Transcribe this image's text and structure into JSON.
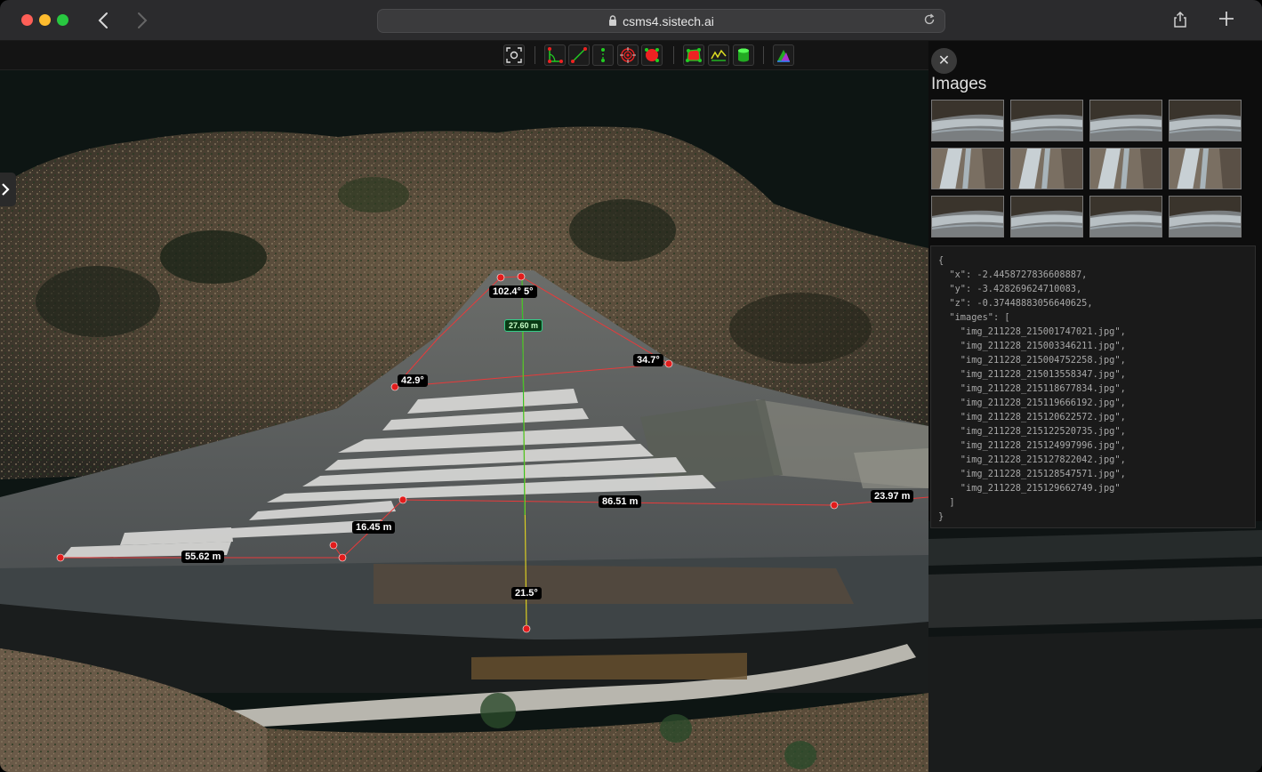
{
  "browser": {
    "url": "csms4.sistech.ai",
    "icons": [
      "back-icon",
      "forward-icon",
      "lock-icon",
      "reload-icon",
      "share-icon",
      "new-tab-icon"
    ]
  },
  "toolbar": {
    "tools": [
      {
        "name": "screenshot-tool",
        "icon": "camera-focus-icon"
      },
      {
        "name": "angle-tool",
        "icon": "angle-icon"
      },
      {
        "name": "distance-tool",
        "icon": "distance-icon"
      },
      {
        "name": "height-tool",
        "icon": "height-icon"
      },
      {
        "name": "point-tool",
        "icon": "target-icon"
      },
      {
        "name": "circle-tool",
        "icon": "circle-icon"
      },
      {
        "name": "area-tool",
        "icon": "area-icon"
      },
      {
        "name": "profile-tool",
        "icon": "profile-icon"
      },
      {
        "name": "volume-tool",
        "icon": "volume-icon"
      },
      {
        "name": "navigation-tool",
        "icon": "triangle-nav-icon"
      }
    ]
  },
  "measurements": {
    "angle_top": "102.4° 5°",
    "height_mid": "27.60 m",
    "angle_left": "42.9°",
    "angle_right": "34.7°",
    "dist_86": "86.51 m",
    "dist_23": "23.97 m",
    "dist_16": "16.45 m",
    "dist_55": "55.62 m",
    "angle_bottom": "21.5°"
  },
  "panel": {
    "title": "Images",
    "close_label": "✕",
    "thumbnail_count": 12,
    "info_lines": [
      "{",
      "  \"x\": -2.4458727836608887,",
      "  \"y\": -3.428269624710083,",
      "  \"z\": -0.37448883056640625,",
      "  \"images\": [",
      "    \"img_211228_215001747021.jpg\",",
      "    \"img_211228_215003346211.jpg\",",
      "    \"img_211228_215004752258.jpg\",",
      "    \"img_211228_215013558347.jpg\",",
      "    \"img_211228_215118677834.jpg\",",
      "    \"img_211228_215119666192.jpg\",",
      "    \"img_211228_215120622572.jpg\",",
      "    \"img_211228_215122520735.jpg\",",
      "    \"img_211228_215124997996.jpg\",",
      "    \"img_211228_215127822042.jpg\",",
      "    \"img_211228_215128547571.jpg\",",
      "    \"img_211228_215129662749.jpg\"",
      "  ]",
      "}"
    ]
  }
}
